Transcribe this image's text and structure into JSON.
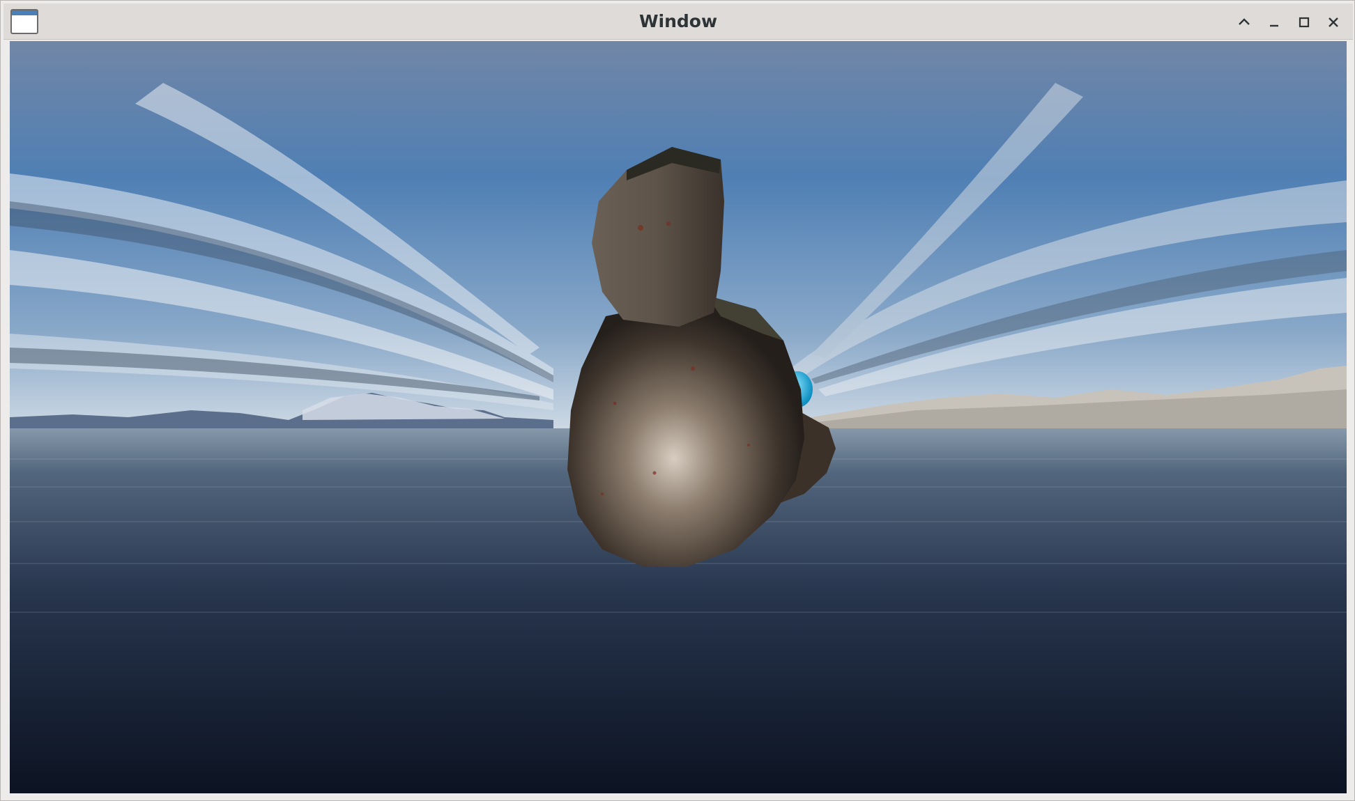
{
  "window": {
    "title": "Window",
    "controls": [
      "shade",
      "minimize",
      "maximize",
      "close"
    ]
  },
  "scene": {
    "description_icons": [
      "sky",
      "mountains",
      "water",
      "bunny-model",
      "blue-sphere"
    ],
    "colors": {
      "sky_top": "#6f85a5",
      "sky_mid": "#4d7db3",
      "horizon": "#c9d6e2",
      "water_near": "#0e1526",
      "water_far": "#6b8296",
      "mountain_right": "#cfcbc3",
      "bunny": "#6a5e52",
      "sphere": "#19b2e0"
    }
  }
}
